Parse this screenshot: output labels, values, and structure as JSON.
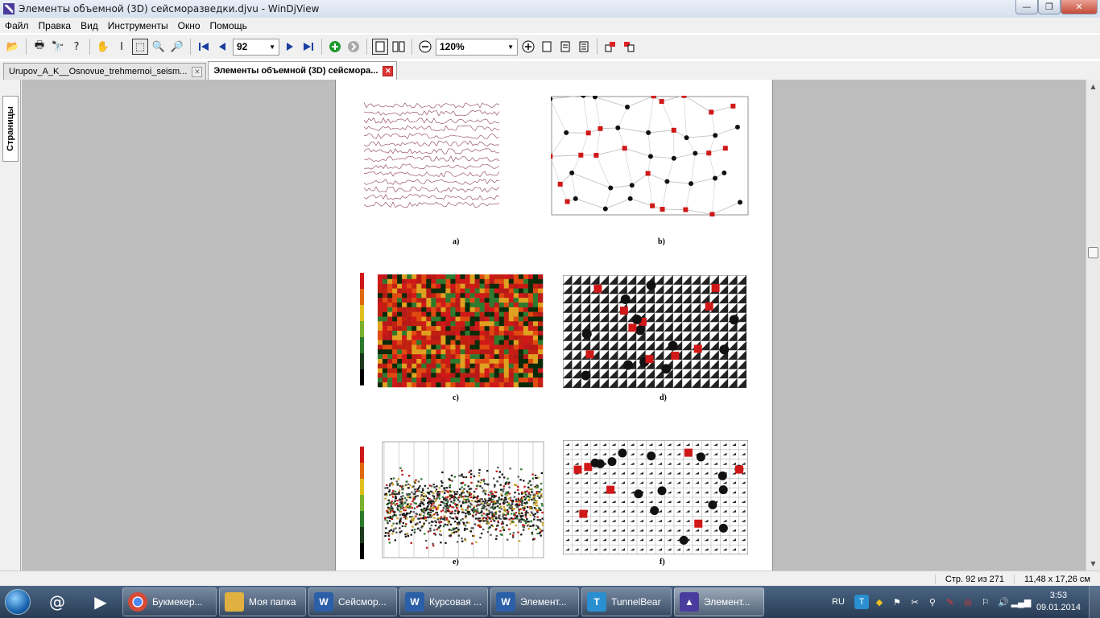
{
  "window": {
    "title": "Элементы объемной (3D) сейсморазведки.djvu - WinDjView",
    "min_label": "—",
    "max_label": "❐",
    "close_label": "✕"
  },
  "menu": [
    "Файл",
    "Правка",
    "Вид",
    "Инструменты",
    "Окно",
    "Помощь"
  ],
  "toolbar": {
    "page_value": "92",
    "zoom_value": "120%"
  },
  "tabs": [
    {
      "label": "Urupov_A_K__Osnovue_trehmernoi_seism...",
      "active": false
    },
    {
      "label": "Элементы объемной (3D) сейсмора...",
      "active": true
    }
  ],
  "side_panel": {
    "label": "Страницы"
  },
  "page_figures": {
    "a": "a)",
    "b": "b)",
    "c": "c)",
    "d": "d)",
    "e": "e)",
    "f": "f)"
  },
  "status": {
    "page": "Стр. 92 из 271",
    "size": "11,48 x 17,26 см"
  },
  "taskbar": {
    "tasks": [
      {
        "label": "Букмекер...",
        "icon": "chrome-icon",
        "color": "#d64a37"
      },
      {
        "label": "Моя папка",
        "icon": "folder-icon",
        "color": "#e0b040"
      },
      {
        "label": "Сейсмор...",
        "icon": "word-icon",
        "color": "#2b5fa8"
      },
      {
        "label": "Курсовая ...",
        "icon": "word-icon",
        "color": "#2b5fa8"
      },
      {
        "label": "Элемент...",
        "icon": "word-icon",
        "color": "#2b5fa8"
      },
      {
        "label": "TunnelBear",
        "icon": "tunnelbear-icon",
        "color": "#2a8fd0"
      },
      {
        "label": "Элемент...",
        "icon": "windjview-icon",
        "color": "#4a3c9c"
      }
    ],
    "lang": "RU",
    "time": "3:53",
    "date": "09.01.2014"
  },
  "colors": {
    "red_marker": "#d01818",
    "black_marker": "#111111",
    "doc_bg": "#bdbdbd"
  }
}
